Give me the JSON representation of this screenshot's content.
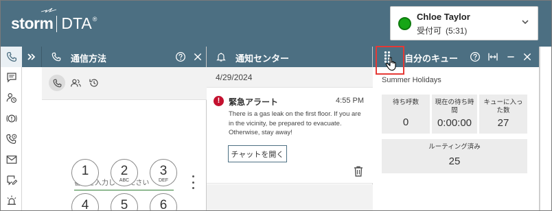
{
  "brand": {
    "logo_storm": "storm",
    "logo_dta": "DTA",
    "logo_reg": "®"
  },
  "user": {
    "name": "Chloe Taylor",
    "status": "受付可",
    "timer": "(5:31)",
    "status_color": "#16a616"
  },
  "colors": {
    "header": "#4c6f82",
    "alert": "#c4112f",
    "highlight": "#e53935",
    "input_underline": "#2e7d32"
  },
  "rail": {
    "items": [
      {
        "icon": "phone-icon"
      },
      {
        "icon": "chat-icon"
      },
      {
        "icon": "user-clock-icon"
      },
      {
        "icon": "alert-circle-icon"
      },
      {
        "icon": "phone-history-icon"
      },
      {
        "icon": "mail-icon"
      },
      {
        "icon": "edit-message-icon"
      },
      {
        "icon": "alarm-light-icon"
      }
    ]
  },
  "panels": {
    "communication": {
      "title": "通信方法",
      "dial_placeholder": "番号を入力してください",
      "keys": [
        {
          "num": "1",
          "letters": ""
        },
        {
          "num": "2",
          "letters": "ABC"
        },
        {
          "num": "3",
          "letters": "DEF"
        },
        {
          "num": "4",
          "letters": ""
        },
        {
          "num": "5",
          "letters": ""
        },
        {
          "num": "6",
          "letters": ""
        }
      ]
    },
    "notifications": {
      "title": "通知センター",
      "date": "4/29/2024",
      "alert": {
        "title": "緊急アラート",
        "time": "4:55 PM",
        "body": "There is a gas leak on the first floor. If you are in the vicinity, be prepared to evacuate. Otherwise, stay away!",
        "button": "チャットを開く"
      }
    },
    "queue": {
      "title": "自分のキュー",
      "queue_name": "Summer Holidays",
      "stats": [
        {
          "label": "待ち呼数",
          "value": "0"
        },
        {
          "label": "現在の待ち時間",
          "value": "0:00:00"
        },
        {
          "label": "キューに入った数",
          "value": "27"
        }
      ],
      "routed": {
        "label": "ルーティング済み",
        "value": "25"
      }
    }
  }
}
